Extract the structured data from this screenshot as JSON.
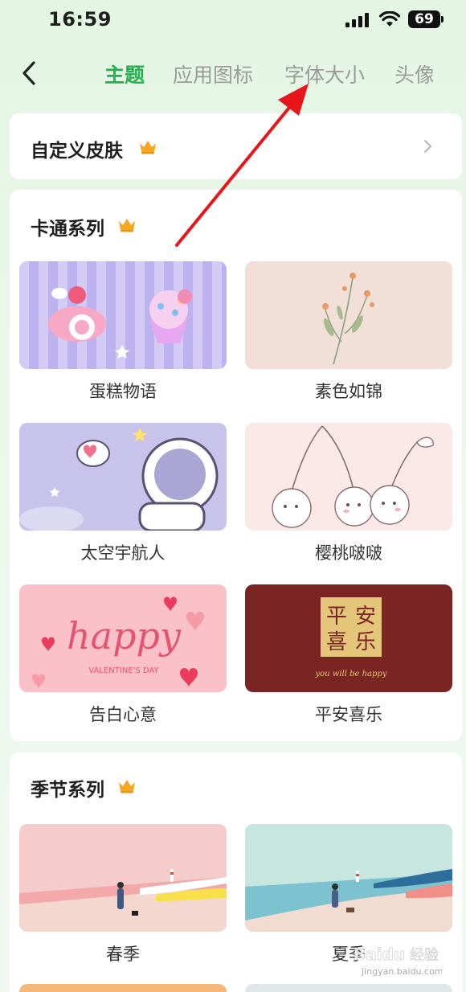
{
  "status": {
    "time": "16:59",
    "battery": "69"
  },
  "tabs": [
    {
      "label": "主题",
      "active": true
    },
    {
      "label": "应用图标"
    },
    {
      "label": "字体大小"
    },
    {
      "label": "头像"
    }
  ],
  "custom_skin": {
    "title": "自定义皮肤"
  },
  "sections": [
    {
      "title": "卡通系列",
      "items": [
        {
          "label": "蛋糕物语"
        },
        {
          "label": "素色如锦"
        },
        {
          "label": "太空宇航人"
        },
        {
          "label": "樱桃啵啵"
        },
        {
          "label": "告白心意",
          "art_text": "happy",
          "art_sub": "VALENTINE'S DAY"
        },
        {
          "label": "平安喜乐",
          "art_chars": [
            "平",
            "安",
            "喜",
            "乐"
          ],
          "art_sub": "you will be happy"
        }
      ]
    },
    {
      "title": "季节系列",
      "items": [
        {
          "label": "春季"
        },
        {
          "label": "夏季"
        }
      ]
    }
  ],
  "watermark": {
    "brand": "Baidu",
    "sub_label": "经验",
    "url": "jingyan.baidu.com"
  },
  "colors": {
    "accent": "#22b14c",
    "crown": "#f5a623",
    "annotation_arrow": "#e8151b"
  },
  "icons": [
    "back-arrow-icon",
    "crown-icon",
    "chevron-right-icon",
    "signal-icon",
    "wifi-icon",
    "battery-icon"
  ]
}
